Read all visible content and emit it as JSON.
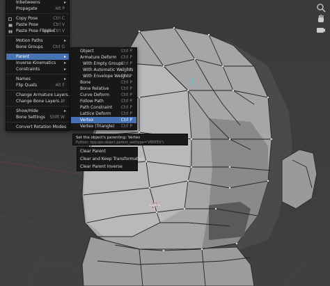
{
  "main_menu": {
    "items": [
      {
        "label": "Inbetweens",
        "shortcut": "",
        "submenu": true
      },
      {
        "label": "Propagate",
        "shortcut": "Alt P",
        "submenu": false
      },
      {
        "label": "Copy Pose",
        "shortcut": "Ctrl C",
        "icon": "copy-icon"
      },
      {
        "label": "Paste Pose",
        "shortcut": "Ctrl V",
        "icon": "paste-icon"
      },
      {
        "label": "Paste Pose Flipped",
        "shortcut": "Shift Ctrl V",
        "icon": "paste-flipped-icon"
      },
      {
        "label": "Motion Paths",
        "shortcut": "",
        "submenu": true
      },
      {
        "label": "Bone Groups",
        "shortcut": "Ctrl G"
      },
      {
        "label": "Parent",
        "shortcut": "",
        "submenu": true,
        "highlighted": true
      },
      {
        "label": "Inverse Kinematics",
        "shortcut": "",
        "submenu": true
      },
      {
        "label": "Constraints",
        "shortcut": "",
        "submenu": true
      },
      {
        "label": "Names",
        "shortcut": "",
        "submenu": true
      },
      {
        "label": "Flip Quats",
        "shortcut": "Alt F"
      },
      {
        "label": "Change Armature Layers...",
        "shortcut": ""
      },
      {
        "label": "Change Bone Layers...",
        "shortcut": "M"
      },
      {
        "label": "Show/Hide",
        "shortcut": "",
        "submenu": true
      },
      {
        "label": "Bone Settings",
        "shortcut": "Shift W"
      },
      {
        "label": "Convert Rotation Modes",
        "shortcut": ""
      }
    ]
  },
  "parent_menu": {
    "items": [
      {
        "label": "Object",
        "shortcut": "Ctrl P"
      },
      {
        "label": "Armature Deform",
        "shortcut": "Ctrl P"
      },
      {
        "label": "With Empty Groups",
        "shortcut": "Ctrl P",
        "indent": true
      },
      {
        "label": "With Automatic Weights",
        "shortcut": "Ctrl P",
        "indent": true
      },
      {
        "label": "With Envelope Weights",
        "shortcut": "Ctrl P",
        "indent": true
      },
      {
        "label": "Bone",
        "shortcut": "Ctrl P"
      },
      {
        "label": "Bone Relative",
        "shortcut": "Ctrl P"
      },
      {
        "label": "Curve Deform",
        "shortcut": "Ctrl P"
      },
      {
        "label": "Follow Path",
        "shortcut": "Ctrl P"
      },
      {
        "label": "Path Constraint",
        "shortcut": "Ctrl P"
      },
      {
        "label": "Lattice Deform",
        "shortcut": "Ctrl P"
      },
      {
        "label": "Vertex",
        "shortcut": "Ctrl P",
        "highlighted": true
      },
      {
        "label": "Vertex (Triangle)",
        "shortcut": "Ctrl P"
      }
    ]
  },
  "tooltip": {
    "description": "Set the object's parenting:  Vertex",
    "python": "Python:  bpy.ops.object.parent_set(type='VERTEX')"
  },
  "clear_menu": {
    "items": [
      {
        "label": "Clear Parent"
      },
      {
        "label": "Clear and Keep Transformation"
      },
      {
        "label": "Clear Parent Inverse"
      }
    ]
  },
  "toolbar": {
    "icons": [
      "zoom-icon",
      "hand-pan-icon",
      "camera-icon"
    ]
  },
  "colors": {
    "menu_bg": "#181818",
    "highlight": "#4772b3",
    "viewport_bg": "#3d3d3d"
  }
}
